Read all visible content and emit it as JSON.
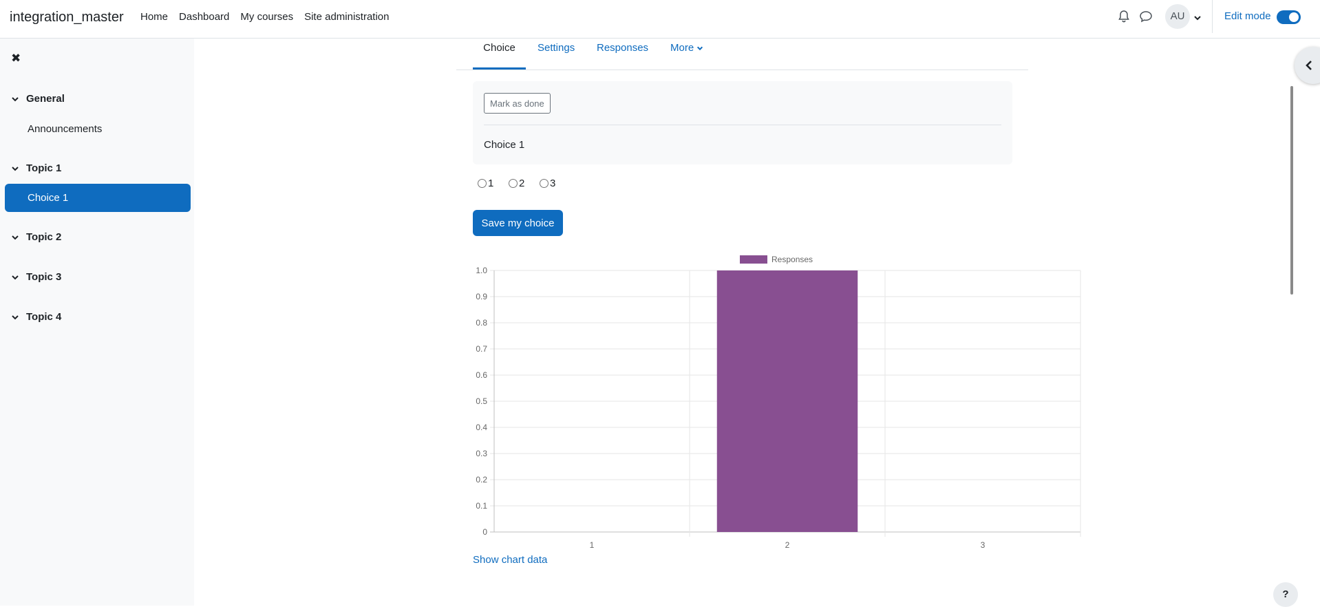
{
  "navbar": {
    "site_name": "integration_master",
    "links": [
      "Home",
      "Dashboard",
      "My courses",
      "Site administration"
    ],
    "user_initials": "AU",
    "edit_mode_label": "Edit mode",
    "edit_mode_on": true
  },
  "drawer": {
    "sections": [
      {
        "title": "General",
        "items": [
          "Announcements"
        ]
      },
      {
        "title": "Topic 1",
        "items": [
          "Choice 1"
        ]
      },
      {
        "title": "Topic 2",
        "items": []
      },
      {
        "title": "Topic 3",
        "items": []
      },
      {
        "title": "Topic 4",
        "items": []
      }
    ],
    "active_item": "Choice 1"
  },
  "secondary_nav": {
    "tabs": [
      "Choice",
      "Settings",
      "Responses",
      "More"
    ],
    "active_tab": "Choice"
  },
  "activity": {
    "mark_done_label": "Mark as done",
    "title": "Choice 1",
    "options": [
      "1",
      "2",
      "3"
    ],
    "save_label": "Save my choice",
    "show_chart_data_label": "Show chart data"
  },
  "help_label": "?",
  "colors": {
    "primary": "#0f6cbf",
    "bar": "#884f91",
    "drawer_bg": "#f8f9fa"
  },
  "chart_data": {
    "type": "bar",
    "categories": [
      "1",
      "2",
      "3"
    ],
    "series": [
      {
        "name": "Responses",
        "values": [
          0,
          1,
          0
        ]
      }
    ],
    "ylim": [
      0,
      1
    ],
    "yticks": [
      "0",
      "0.1",
      "0.2",
      "0.3",
      "0.4",
      "0.5",
      "0.6",
      "0.7",
      "0.8",
      "0.9",
      "1.0"
    ],
    "legend": "top",
    "grid": true
  }
}
